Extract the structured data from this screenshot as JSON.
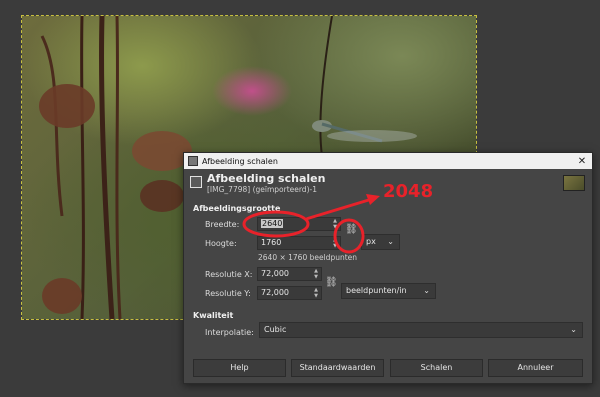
{
  "dialog": {
    "window_title": "Afbeelding schalen",
    "header_title": "Afbeelding schalen",
    "header_subtitle": "[IMG_7798] (geïmporteerd)-1",
    "close_glyph": "✕",
    "section_size": "Afbeeldingsgrootte",
    "width_label": "Breedte:",
    "width_value": "2640",
    "height_label": "Hoogte:",
    "height_value": "1760",
    "unit_px": "px",
    "size_hint": "2640 × 1760 beeldpunten",
    "res_x_label": "Resolutie X:",
    "res_x_value": "72,000",
    "res_y_label": "Resolutie Y:",
    "res_y_value": "72,000",
    "res_unit": "beeldpunten/in",
    "section_quality": "Kwaliteit",
    "interp_label": "Interpolatie:",
    "interp_value": "Cubic",
    "buttons": {
      "help": "Help",
      "reset": "Standaardwaarden",
      "scale": "Schalen",
      "cancel": "Annuleer"
    }
  },
  "annotation": {
    "text": "2048",
    "color": "#e8222a"
  },
  "icons": {
    "chain": "chain-link-icon",
    "spin_arrows": "spin-arrows-icon",
    "dropdown": "chevron-down-icon"
  }
}
